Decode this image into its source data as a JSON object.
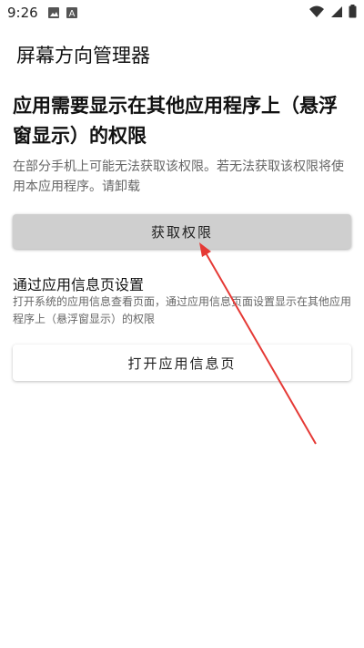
{
  "status_bar": {
    "time": "9:26",
    "left_icons": [
      "image-icon",
      "text-a-icon"
    ],
    "right_icons": [
      "wifi-icon",
      "cellular-signal-icon",
      "battery-icon"
    ]
  },
  "app_bar": {
    "title": "屏幕方向管理器"
  },
  "permission_section": {
    "heading": "应用需要显示在其他应用程序上（悬浮窗显示）的权限",
    "description": "在部分手机上可能无法获取该权限。若无法获取该权限将使用本应用程序。请卸载",
    "grant_button_label": "获取权限"
  },
  "app_info_section": {
    "title": "通过应用信息页设置",
    "description": "打开系统的应用信息查看页面，通过应用信息页面设置显示在其他应用程序上（悬浮窗显示）的权限",
    "open_button_label": "打开应用信息页"
  },
  "colors": {
    "annotation_arrow": "#e53935",
    "grant_button_bg": "#cfcfcf",
    "secondary_text": "#666666"
  }
}
